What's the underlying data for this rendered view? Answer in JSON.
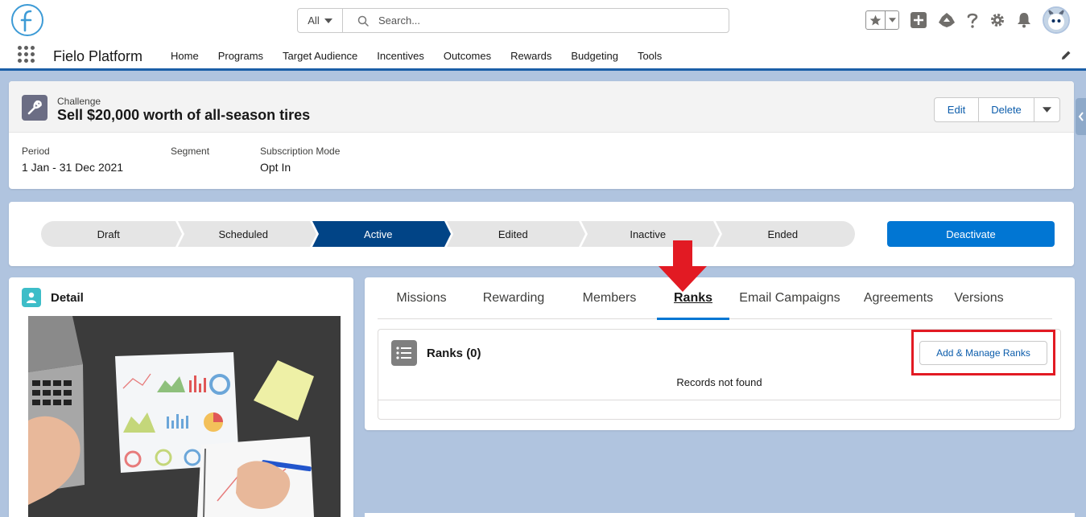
{
  "header": {
    "search_scope": "All",
    "search_placeholder": "Search..."
  },
  "nav": {
    "app_name": "Fielo Platform",
    "items": [
      "Home",
      "Programs",
      "Target Audience",
      "Incentives",
      "Outcomes",
      "Rewards",
      "Budgeting",
      "Tools"
    ]
  },
  "record": {
    "type": "Challenge",
    "title": "Sell $20,000 worth of all-season tires",
    "actions": {
      "edit": "Edit",
      "delete": "Delete"
    },
    "fields": [
      {
        "label": "Period",
        "value": "1 Jan - 31 Dec 2021"
      },
      {
        "label": "Segment",
        "value": ""
      },
      {
        "label": "Subscription Mode",
        "value": "Opt In"
      }
    ]
  },
  "path": {
    "steps": [
      "Draft",
      "Scheduled",
      "Active",
      "Edited",
      "Inactive",
      "Ended"
    ],
    "active_index": 2,
    "action_label": "Deactivate",
    "active_color": "#014486"
  },
  "detail": {
    "title": "Detail"
  },
  "tabs": {
    "items": [
      "Missions",
      "Rewarding",
      "Members",
      "Ranks",
      "Email Campaigns",
      "Agreements",
      "Versions"
    ],
    "active_index": 3
  },
  "related": {
    "title": "Ranks (0)",
    "button_label": "Add & Manage Ranks",
    "empty_text": "Records not found"
  },
  "colors": {
    "brand": "#0176d3",
    "highlight": "#e21a23"
  }
}
